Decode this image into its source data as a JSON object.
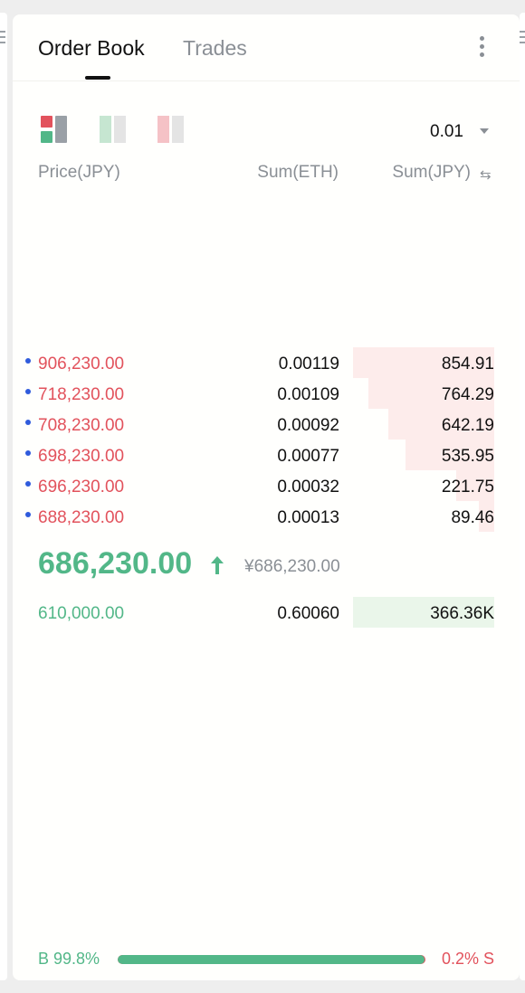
{
  "header": {
    "tabs": [
      {
        "label": "Order Book",
        "active": true
      },
      {
        "label": "Trades",
        "active": false
      }
    ],
    "more_icon": "vertical-ellipsis"
  },
  "toolbar": {
    "layouts": [
      "both",
      "buy-only",
      "sell-only"
    ],
    "precision": "0.01"
  },
  "columns": {
    "price": "Price(JPY)",
    "sum_eth": "Sum(ETH)",
    "sum_jpy": "Sum(JPY)",
    "swap_icon": "⇆"
  },
  "asks": [
    {
      "price": "906,230.00",
      "sum_eth": "0.00119",
      "sum_jpy": "854.91",
      "depth": 1.0
    },
    {
      "price": "718,230.00",
      "sum_eth": "0.00109",
      "sum_jpy": "764.29",
      "depth": 0.89
    },
    {
      "price": "708,230.00",
      "sum_eth": "0.00092",
      "sum_jpy": "642.19",
      "depth": 0.75
    },
    {
      "price": "698,230.00",
      "sum_eth": "0.00077",
      "sum_jpy": "535.95",
      "depth": 0.63
    },
    {
      "price": "696,230.00",
      "sum_eth": "0.00032",
      "sum_jpy": "221.75",
      "depth": 0.27
    },
    {
      "price": "688,230.00",
      "sum_eth": "0.00013",
      "sum_jpy": "89.46",
      "depth": 0.11
    }
  ],
  "last_trade": {
    "price": "686,230.00",
    "direction": "up",
    "fiat": "¥686,230.00"
  },
  "bids": [
    {
      "price": "610,000.00",
      "sum_eth": "0.60060",
      "sum_jpy": "366.36K",
      "depth": 1.0
    }
  ],
  "ratio": {
    "buy_label": "B 99.8%",
    "sell_label": "0.2% S",
    "buy_fraction": 0.998
  },
  "colors": {
    "sell": "#e2525c",
    "buy": "#52b788",
    "order_dot": "#2f5bdc"
  }
}
